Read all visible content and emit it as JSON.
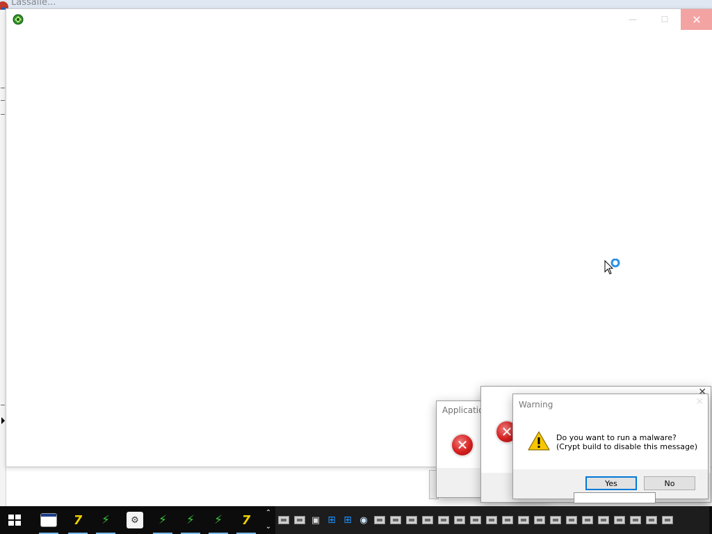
{
  "background_window": {
    "title": "Lassalle..."
  },
  "main_window": {
    "minimize_glyph": "—",
    "maximize_glyph": "☐",
    "close_glyph": "✕"
  },
  "dialogs": {
    "app_error": {
      "title": "Application",
      "icon": "error-icon"
    },
    "mid_error": {
      "icon": "error-icon",
      "close_glyph": "✕"
    },
    "warning": {
      "title": "Warning",
      "close_glyph": "✕",
      "message_line1": "Do you want to run a malware?",
      "message_line2": "(Crypt build to disable this message)",
      "yes_label": "Yes",
      "no_label": "No",
      "icon": "warning-icon"
    }
  },
  "taskbar": {
    "items": [
      {
        "name": "window-app-icon",
        "active": true
      },
      {
        "name": "7zip-icon",
        "active": true
      },
      {
        "name": "script-icon",
        "active": true
      },
      {
        "name": "tool-icon",
        "active": false
      },
      {
        "name": "script-icon",
        "active": true
      },
      {
        "name": "script-icon",
        "active": true
      },
      {
        "name": "script-icon",
        "active": true
      },
      {
        "name": "7zip-icon",
        "active": true
      }
    ],
    "scroll_up": "⌃",
    "scroll_down": "⌄",
    "tray_items": [
      "box",
      "box",
      "cube",
      "windows",
      "windows",
      "up-arrow",
      "box",
      "box",
      "box",
      "box",
      "box",
      "box",
      "box",
      "box",
      "box",
      "box",
      "box",
      "box",
      "box",
      "box",
      "box",
      "box",
      "box",
      "box",
      "box"
    ]
  },
  "colors": {
    "taskbar": "#0c0c0c",
    "tray": "#1d1d1d",
    "accent_blue": "#0078d7",
    "error_red": "#d62020",
    "close_hover": "#f4a3a3"
  }
}
